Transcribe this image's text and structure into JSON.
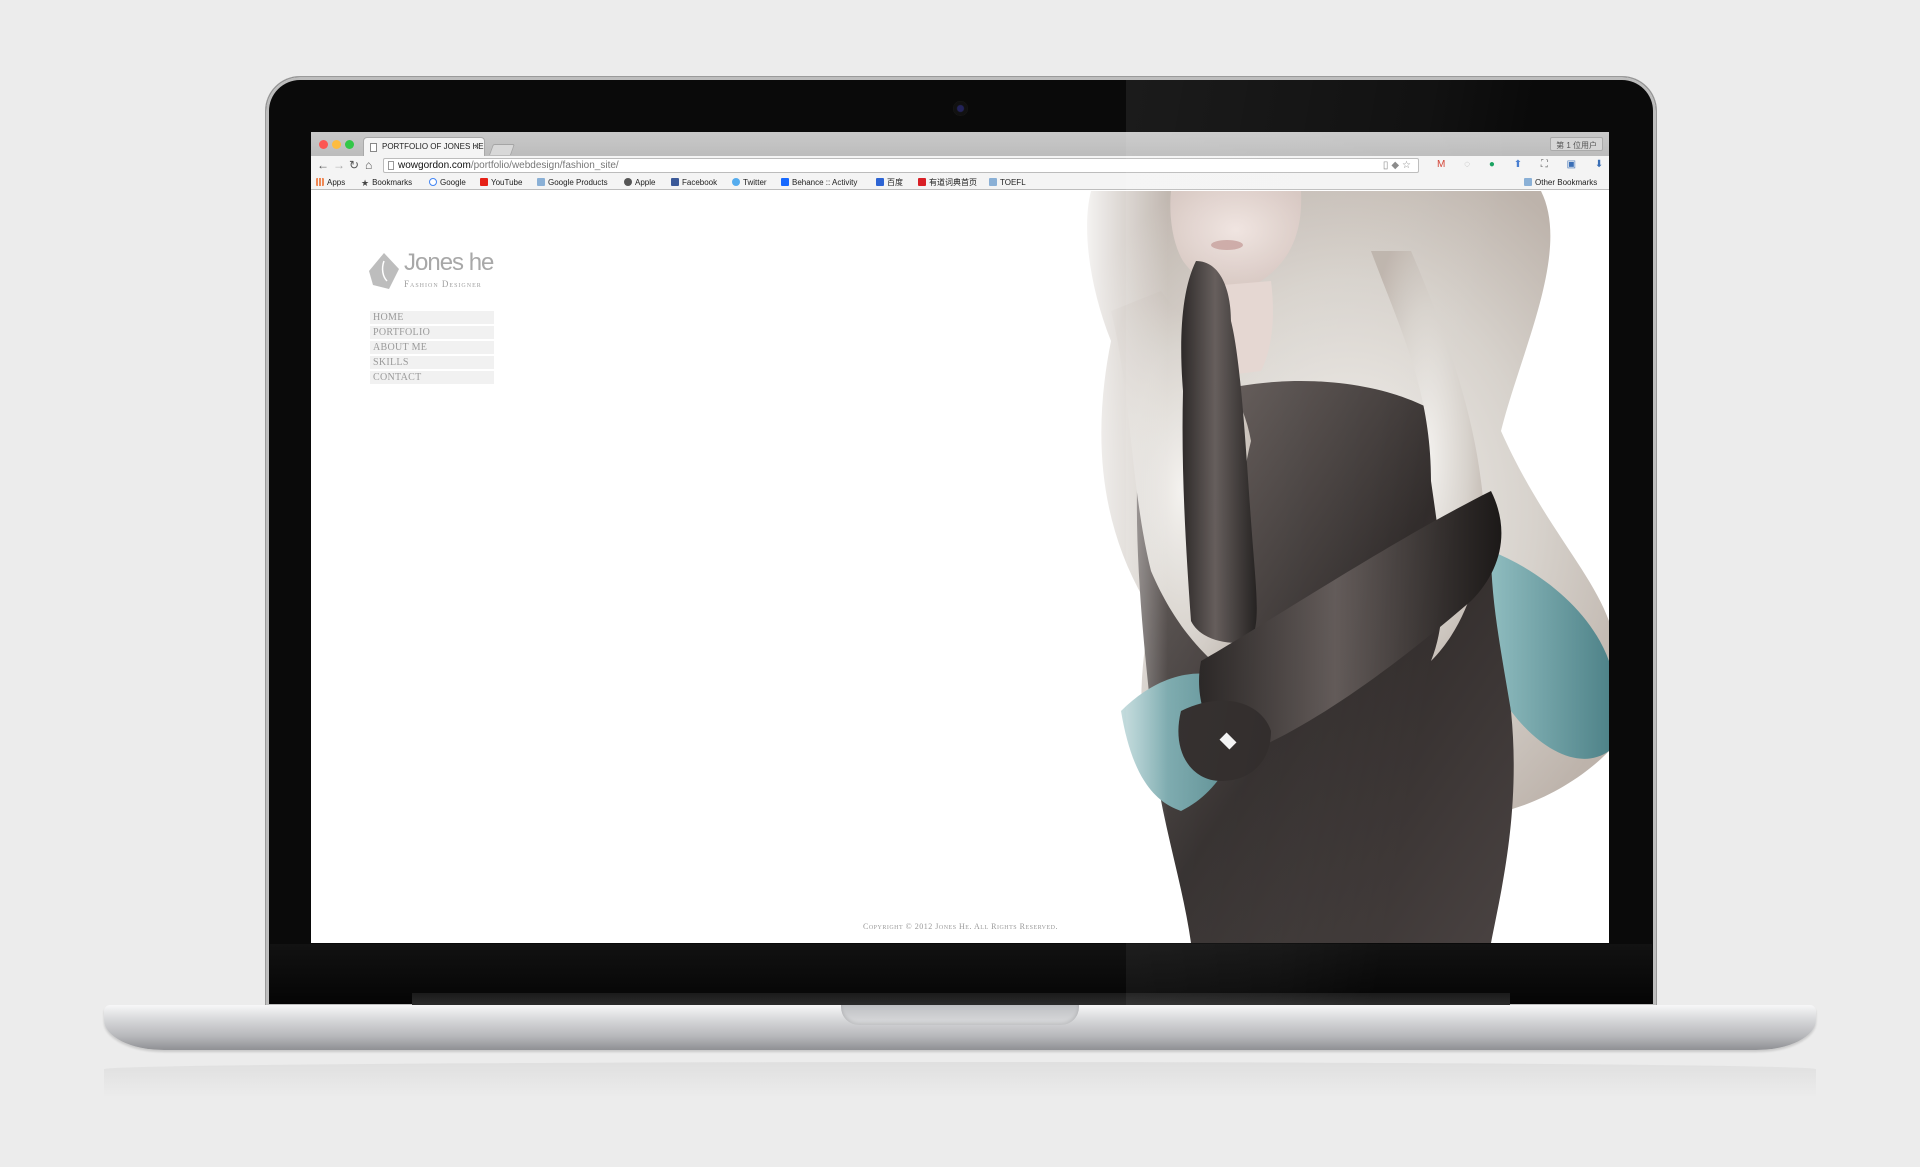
{
  "browser": {
    "tab_title": "PORTFOLIO OF JONES HE",
    "tab_close": "×",
    "user_badge": "第 1 位用户",
    "url_host": "wowgordon.com",
    "url_path": "/portfolio/webdesign/fashion_site/",
    "nav": {
      "back": "←",
      "forward": "→",
      "reload": "↻",
      "home": "⌂"
    },
    "omnibox_icons": "▯◆☆",
    "extensions": [
      "M",
      "◌",
      "●",
      "⬆",
      "⛶",
      "▣",
      "⬇",
      "◙",
      "≡"
    ]
  },
  "bookmarks": {
    "apps": "Apps",
    "items": [
      "Bookmarks",
      "Google",
      "YouTube",
      "Google Products",
      "Apple",
      "Facebook",
      "Twitter",
      "Behance :: Activity",
      "百度",
      "有道词典首页",
      "TOEFL"
    ],
    "other": "Other Bookmarks"
  },
  "site": {
    "logo_name": "Jones he",
    "logo_subtitle": "Fashion Designer",
    "menu": [
      "HOME",
      "PORTFOLIO",
      "ABOUT ME",
      "SKILLS",
      "CONTACT"
    ],
    "copyright": "Copyright © 2012 Jones He. All Rights Reserved."
  },
  "icons": {
    "logo": "diamond-logo-icon",
    "hero": "model-photo"
  },
  "colors": {
    "page_bg": "#ececec",
    "menu_bg": "#f1f1f1",
    "menu_text": "#9a9a9a",
    "traffic_red": "#fc5753",
    "traffic_yellow": "#fdbc40",
    "traffic_green": "#33c748"
  }
}
